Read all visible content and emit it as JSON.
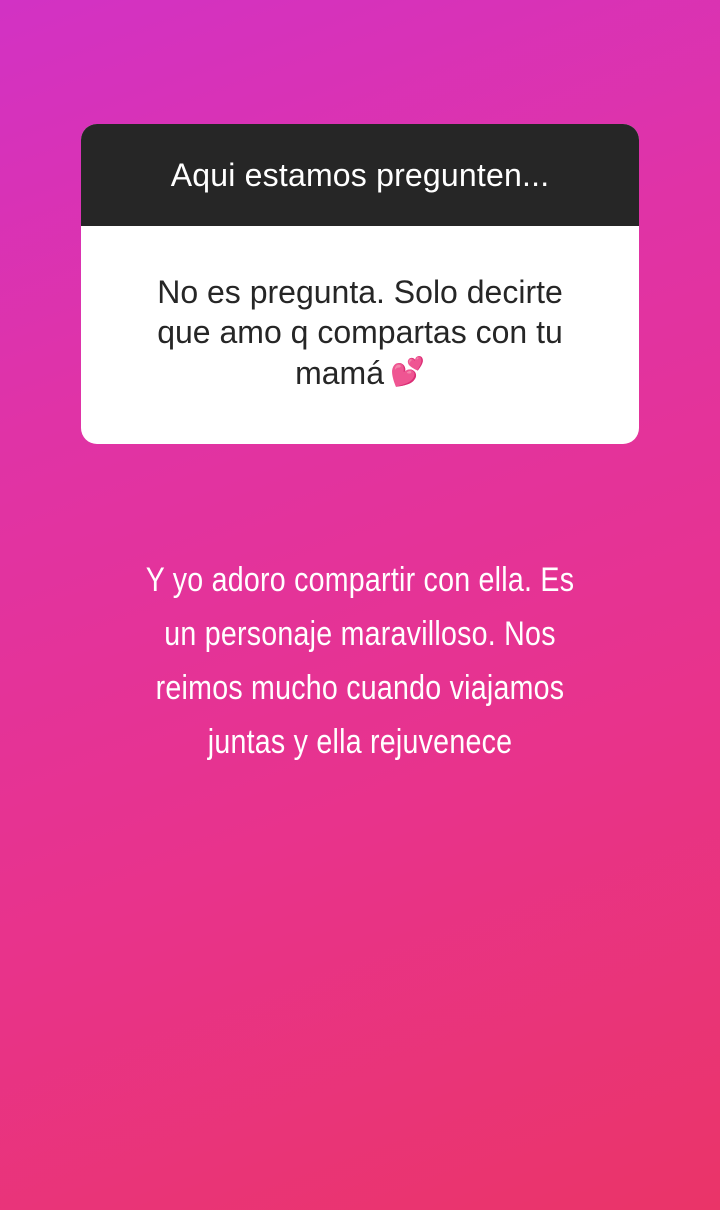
{
  "question_card": {
    "header": "Aqui estamos pregunten...",
    "body_lines": [
      "No es pregunta. Solo decirte",
      "que amo q compartas con tu",
      "mamá"
    ],
    "emoji": "💕"
  },
  "answer": {
    "lines": [
      "Y yo adoro compartir con ella. Es",
      "un personaje maravilloso. Nos",
      "reimos mucho cuando viajamos",
      "juntas y ella rejuvenece"
    ]
  },
  "colors": {
    "gradient_start": "#d232c4",
    "gradient_end": "#ea3468",
    "card_header": "#262626",
    "card_body": "#ffffff"
  }
}
